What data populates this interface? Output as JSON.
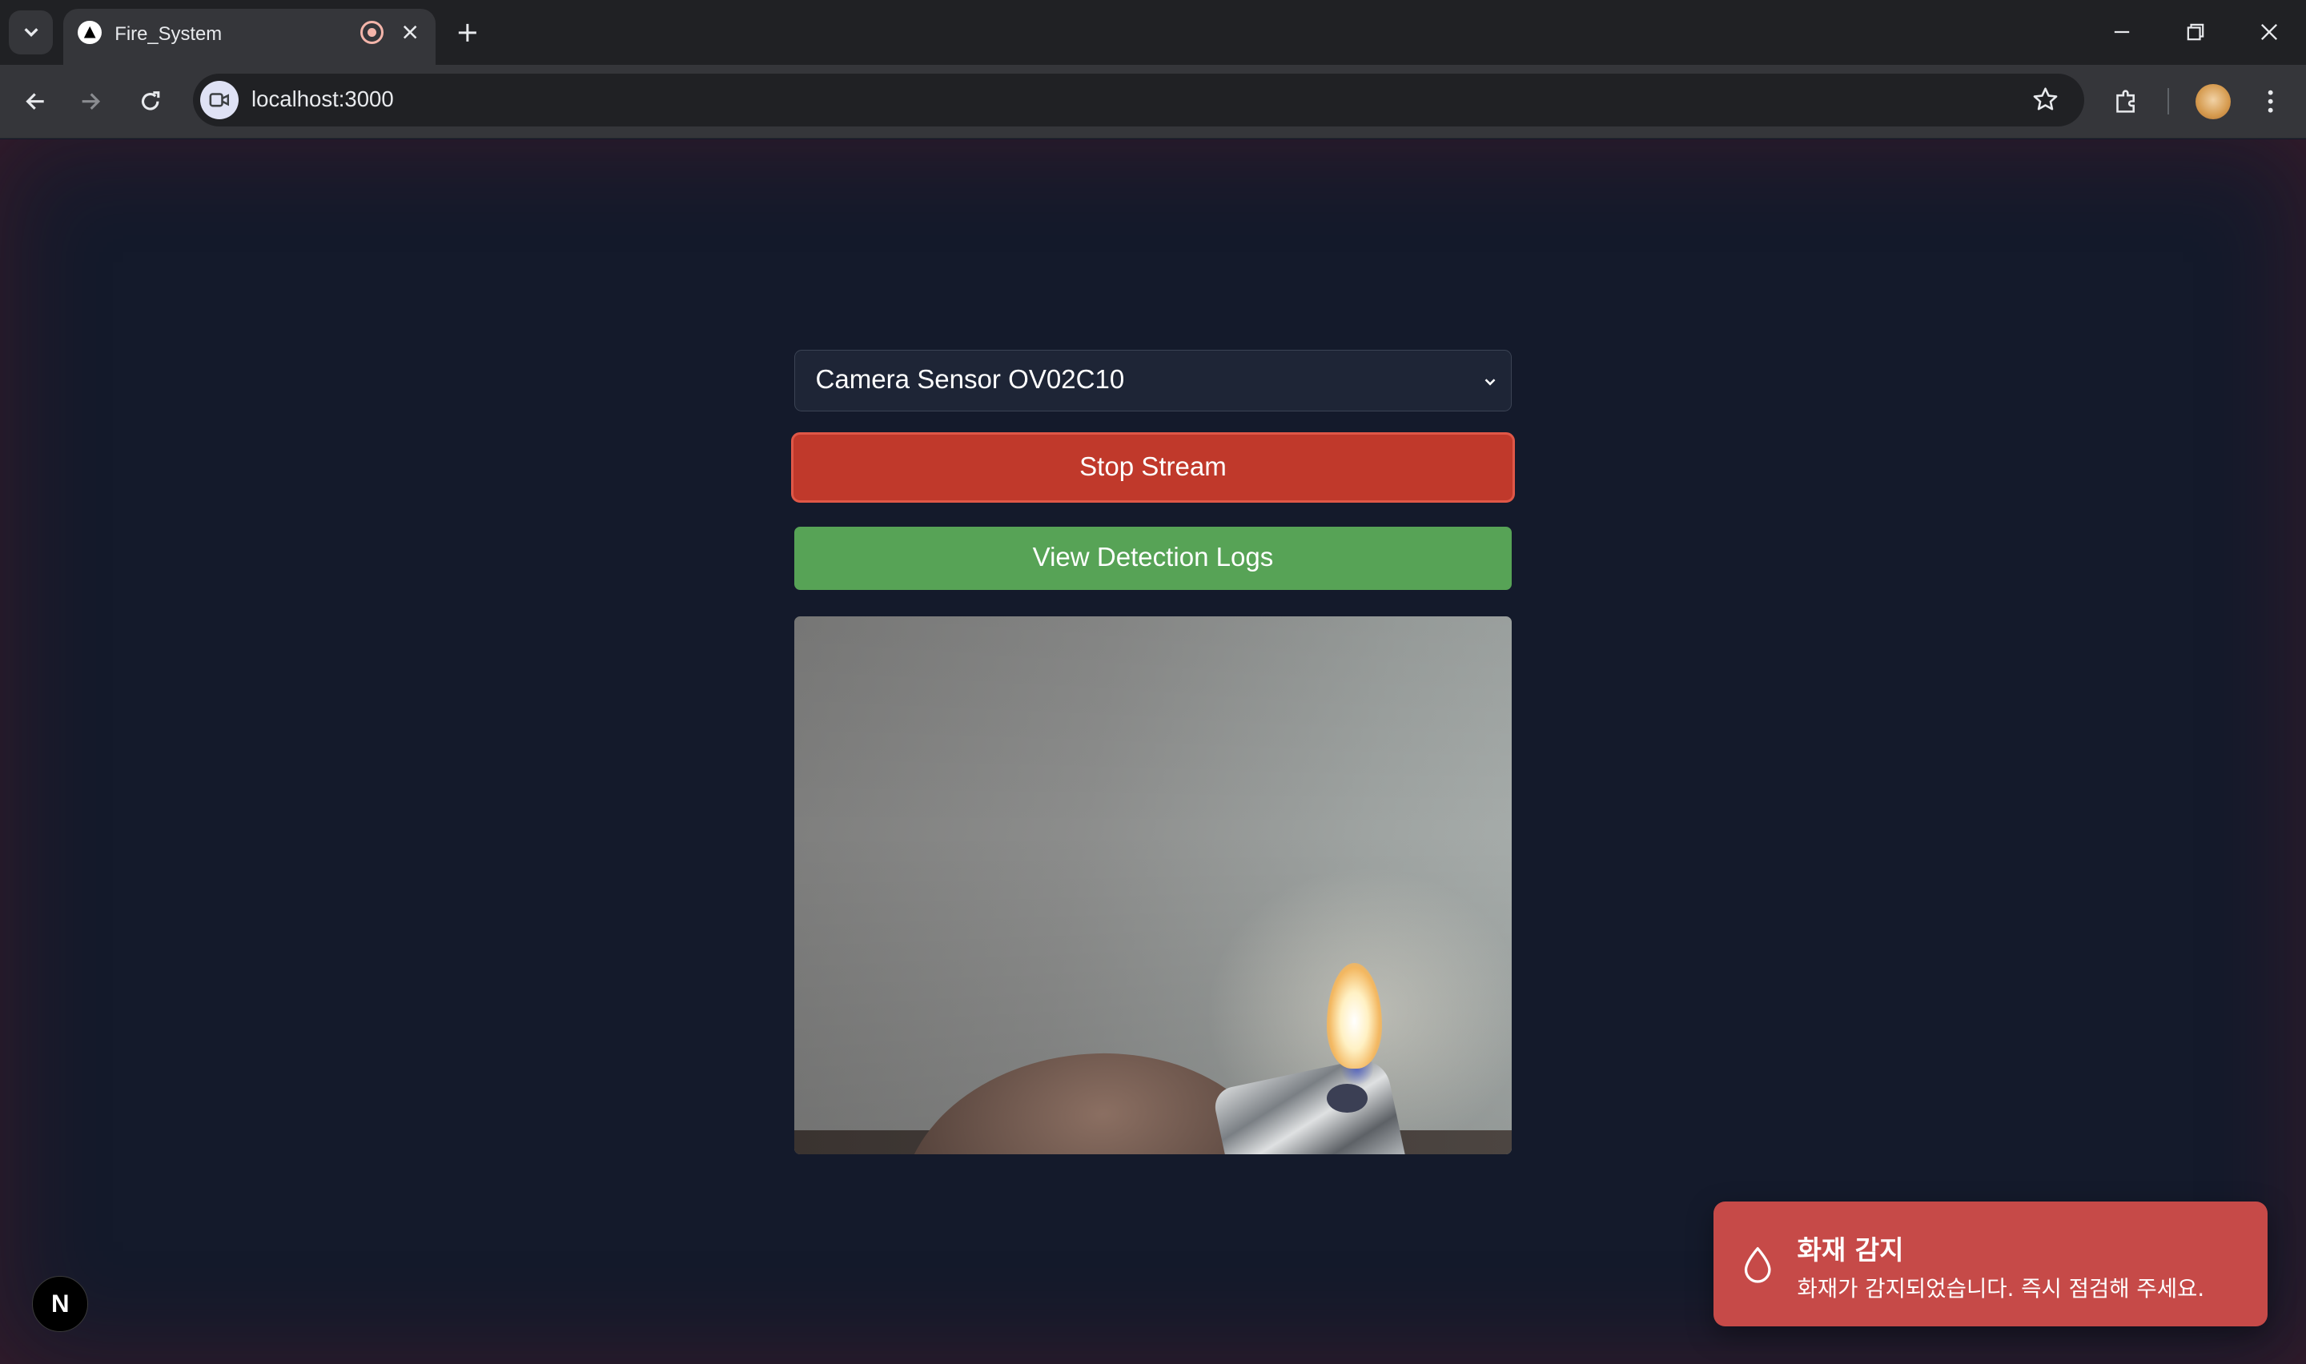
{
  "browser": {
    "tab_title": "Fire_System",
    "url": "localhost:3000"
  },
  "page": {
    "camera_select": {
      "selected": "Camera Sensor OV02C10"
    },
    "stop_stream_label": "Stop Stream",
    "view_logs_label": "View Detection Logs",
    "colors": {
      "background": "#141a2b",
      "stop_button": "#c0392b",
      "logs_button": "#57a356",
      "toast": "#c64a48"
    }
  },
  "framework_badge": {
    "letter": "N"
  },
  "toast": {
    "icon": "flame-outline-icon",
    "title": "화재 감지",
    "message": "화재가 감지되었습니다. 즉시 점검해 주세요."
  }
}
